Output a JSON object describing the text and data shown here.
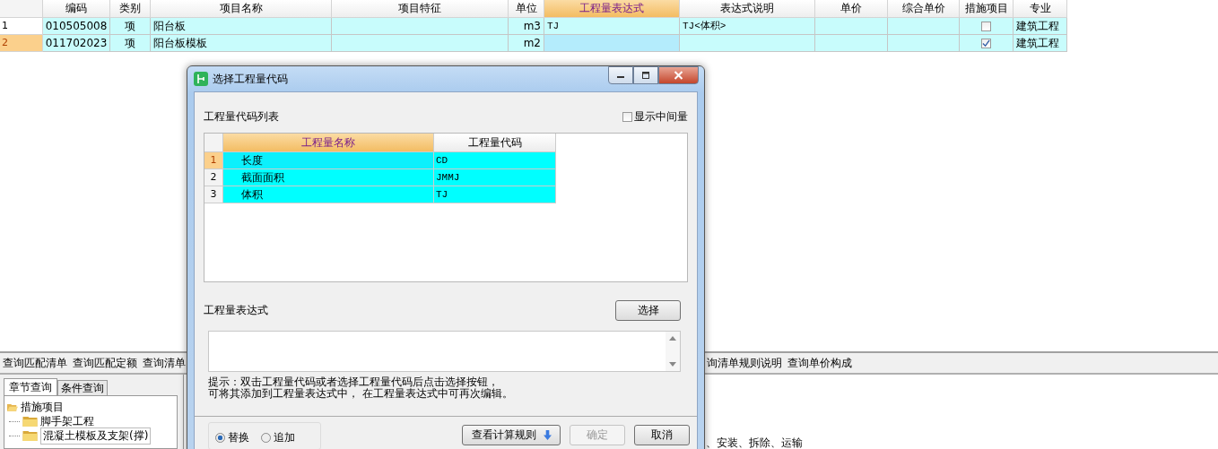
{
  "main_table": {
    "columns": [
      {
        "label": "编码",
        "selected": false
      },
      {
        "label": "类别",
        "selected": false
      },
      {
        "label": "项目名称",
        "selected": false
      },
      {
        "label": "项目特征",
        "selected": false
      },
      {
        "label": "单位",
        "selected": false
      },
      {
        "label": "工程量表达式",
        "selected": true
      },
      {
        "label": "表达式说明",
        "selected": false
      },
      {
        "label": "单价",
        "selected": false
      },
      {
        "label": "综合单价",
        "selected": false
      },
      {
        "label": "措施项目",
        "selected": false
      },
      {
        "label": "专业",
        "selected": false
      }
    ],
    "rows": [
      {
        "number": "1",
        "selected": false,
        "code": "010505008",
        "category": "项",
        "name": "阳台板",
        "unit": "m3",
        "expression": "TJ",
        "note": "TJ<体积>",
        "measure_checked": false,
        "specialty": "建筑工程"
      },
      {
        "number": "2",
        "selected": true,
        "code": "011702023",
        "category": "项",
        "name": "阳台板模板",
        "unit": "m2",
        "measure_checked": true,
        "specialty": "建筑工程"
      }
    ]
  },
  "bottom_panel": {
    "left_links": [
      "查询匹配清单",
      "查询匹配定额",
      "查询清单"
    ],
    "right_links": [
      "询清单规则说明",
      "查询单价构成"
    ],
    "tabs": [
      {
        "label": "章节查询",
        "selected": true
      },
      {
        "label": "条件查询",
        "selected": false
      }
    ],
    "tree": [
      {
        "label": "措施项目",
        "expanded": true,
        "children": [
          {
            "label": "脚手架工程",
            "selected": false
          },
          {
            "label": "混凝土模板及支架(撑)",
            "selected": true
          }
        ]
      }
    ],
    "content_text": "、安装、拆除、运输"
  },
  "dialog": {
    "title": "选择工程量代码",
    "list_label": "工程量代码列表",
    "show_intermediate": {
      "label": "显示中间量",
      "checked": false
    },
    "code_table": {
      "columns": [
        {
          "label": "工程量名称",
          "selected": true
        },
        {
          "label": "工程量代码",
          "selected": false
        }
      ],
      "rows": [
        {
          "number": "1",
          "selected": true,
          "name": "长度",
          "code": "CD"
        },
        {
          "number": "2",
          "selected": false,
          "name": "截面面积",
          "code": "JMMJ"
        },
        {
          "number": "3",
          "selected": false,
          "name": "体积",
          "code": "TJ"
        }
      ]
    },
    "expression_label": "工程量表达式",
    "select_button": "选择",
    "hint": [
      "提示：双击工程量代码或者选择工程量代码后点击选择按钮，",
      "可将其添加到工程量表达式中， 在工程量表达式中可再次编辑。"
    ],
    "modes": [
      {
        "label": "替换",
        "selected": true
      },
      {
        "label": "追加",
        "selected": false
      }
    ],
    "buttons": [
      {
        "kind": "menu",
        "label": "查看计算规则",
        "disabled": false
      },
      {
        "kind": "plain",
        "label": "确定",
        "disabled": true
      },
      {
        "kind": "plain",
        "label": "取消",
        "disabled": false
      }
    ]
  }
}
